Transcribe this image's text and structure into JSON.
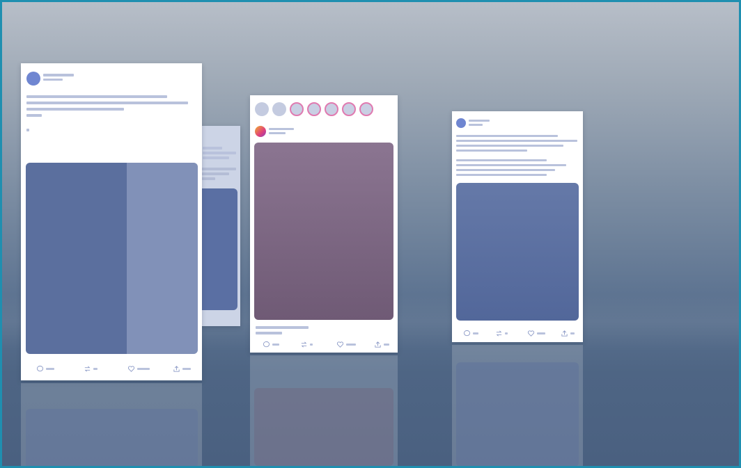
{
  "scene": {
    "accent_border": "#1f8fb0",
    "background_top": "#b7bec8",
    "background_bottom": "#4a6080"
  },
  "cards": [
    {
      "name": "text-post-card",
      "media_color": "#5b6f9e"
    },
    {
      "name": "stories-feed-card",
      "media_color": "#7a6282"
    },
    {
      "name": "text-image-post-card",
      "media_color": "#5a6e9c"
    }
  ],
  "actions": [
    "comment-icon",
    "repost-icon",
    "like-icon",
    "share-icon"
  ],
  "stories": {
    "count": 7,
    "highlighted": 5
  }
}
